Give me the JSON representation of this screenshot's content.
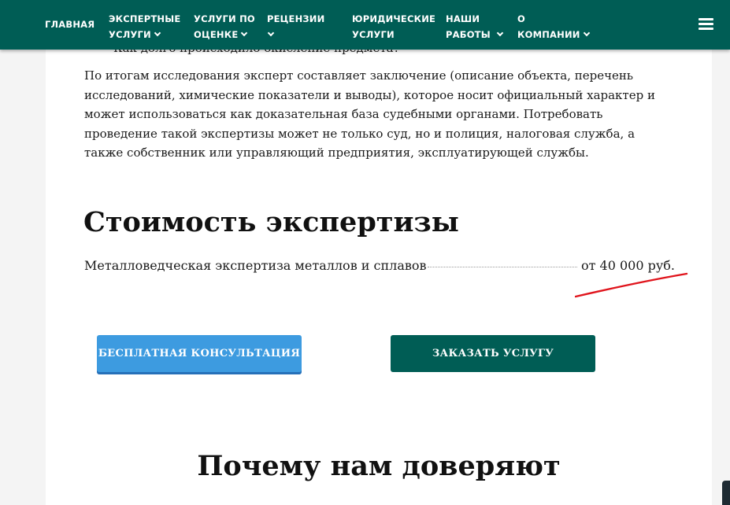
{
  "nav": {
    "items": [
      {
        "line1": "ГЛАВНАЯ",
        "line2": "",
        "dropdown": false
      },
      {
        "line1": "ЭКСПЕРТНЫЕ",
        "line2": "УСЛУГИ",
        "dropdown": true
      },
      {
        "line1": "УСЛУГИ ПО",
        "line2": "ОЦЕНКЕ",
        "dropdown": true
      },
      {
        "line1": "РЕЦЕНЗИИ",
        "line2": "",
        "dropdown": true
      },
      {
        "line1": "ЮРИДИЧЕСКИЕ",
        "line2": "УСЛУГИ",
        "dropdown": false
      },
      {
        "line1": "НАШИ",
        "line2": "РАБОТЫ",
        "dropdown": true
      },
      {
        "line1": "О",
        "line2": "КОМПАНИИ",
        "dropdown": true
      }
    ],
    "menu_icon": "hamburger-icon"
  },
  "content": {
    "clipped_bullet": "Как долго происходило окисление предмета?",
    "paragraph": "По итогам исследования эксперт составляет заключение (описание объекта, перечень исследований, химические показатели и выводы), которое носит официальный характер и может использоваться как доказательная база судебными органами. Потребовать проведение такой экспертизы может не только суд, но и полиция, налоговая служба, а также собственник или управляющий предприятия, эксплуатирующей службы.",
    "cost_heading": "Стоимость экспертизы",
    "price": {
      "name": "Металловедческая экспертиза металлов и сплавов",
      "value": "от 40 000 руб."
    },
    "buttons": {
      "consult": "БЕСПЛАТНАЯ КОНСУЛЬТАЦИЯ",
      "order": "ЗАКАЗАТЬ УСЛУГУ"
    },
    "trust_heading": "Почему нам доверяют"
  },
  "colors": {
    "nav_bg": "#005d55",
    "consult_button": "#3d9be0",
    "order_button": "#005d55",
    "annotation_red": "#e0141c"
  }
}
